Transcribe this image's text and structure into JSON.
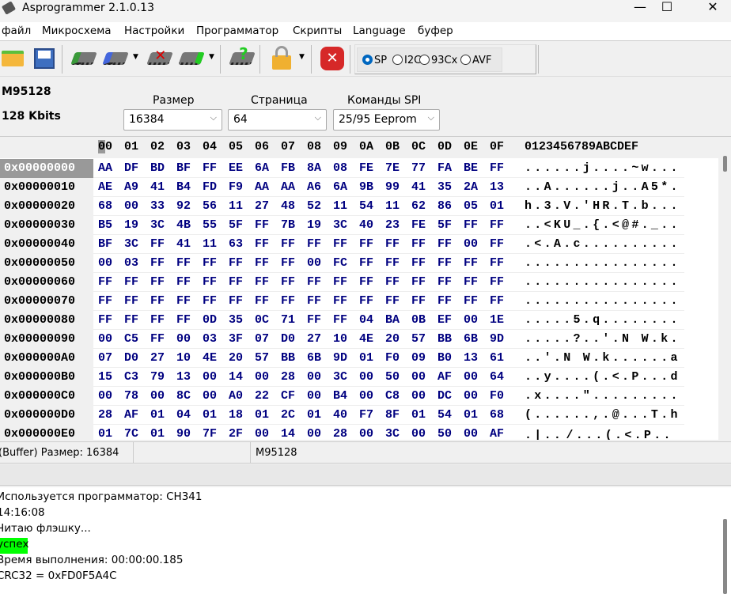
{
  "window": {
    "title": "Asprogrammer 2.1.0.13",
    "minimize": "—",
    "maximize": "☐",
    "close": "✕"
  },
  "menu": [
    "файл",
    "Микросхема",
    "Настройки",
    "Программатор",
    "Скрипты",
    "Language",
    "буфер"
  ],
  "toolbar": {
    "icons": [
      "open-folder-icon",
      "save-icon",
      "read-chip-icon",
      "write-chip-icon",
      "erase-chip-icon",
      "verify-chip-icon",
      "detect-chip-icon",
      "lock-icon",
      "stop-icon"
    ]
  },
  "interfaces": {
    "selected": "SPI",
    "options": [
      "SP",
      "I2C",
      "93Cx",
      "AVF"
    ]
  },
  "chip": {
    "name": "M95128",
    "size_text": "128 Kbits"
  },
  "size": {
    "label": "Размер",
    "value": "16384"
  },
  "page": {
    "label": "Страница",
    "value": "64"
  },
  "spi_commands": {
    "label": "Команды SPI",
    "value": "25/95 Eeprom"
  },
  "hex": {
    "columns": [
      "00",
      "01",
      "02",
      "03",
      "04",
      "05",
      "06",
      "07",
      "08",
      "09",
      "0A",
      "0B",
      "0C",
      "0D",
      "0E",
      "0F"
    ],
    "ascii_header": "0123456789ABCDEF",
    "rows": [
      {
        "addr": "0x00000000",
        "bytes": "AA DF BD BF FF EE 6A FB 8A 08 FE 7E 77 FA BE FF",
        "ascii": "......j....~w..."
      },
      {
        "addr": "0x00000010",
        "bytes": "AE A9 41 B4 FD F9 AA AA A6 6A 9B 99 41 35 2A 13",
        "ascii": "..A......j..A5*."
      },
      {
        "addr": "0x00000020",
        "bytes": "68 00 33 92 56 11 27 48 52 11 54 11 62 86 05 01",
        "ascii": "h.3.V.'HR.T.b..."
      },
      {
        "addr": "0x00000030",
        "bytes": "B5 19 3C 4B 55 5F FF 7B 19 3C 40 23 FE 5F FF FF",
        "ascii": "..<KU_.{.<@#._.."
      },
      {
        "addr": "0x00000040",
        "bytes": "BF 3C FF 41 11 63 FF FF FF FF FF FF FF FF 00 FF",
        "ascii": ".<.A.c.........."
      },
      {
        "addr": "0x00000050",
        "bytes": "00 03 FF FF FF FF FF FF 00 FC FF FF FF FF FF FF",
        "ascii": "................"
      },
      {
        "addr": "0x00000060",
        "bytes": "FF FF FF FF FF FF FF FF FF FF FF FF FF FF FF FF",
        "ascii": "................"
      },
      {
        "addr": "0x00000070",
        "bytes": "FF FF FF FF FF FF FF FF FF FF FF FF FF FF FF FF",
        "ascii": "................"
      },
      {
        "addr": "0x00000080",
        "bytes": "FF FF FF FF 0D 35 0C 71 FF FF 04 BA 0B EF 00 1E",
        "ascii": ".....5.q........"
      },
      {
        "addr": "0x00000090",
        "bytes": "00 C5 FF 00 03 3F 07 D0 27 10 4E 20 57 BB 6B 9D",
        "ascii": ".....?..'.N W.k."
      },
      {
        "addr": "0x000000A0",
        "bytes": "07 D0 27 10 4E 20 57 BB 6B 9D 01 F0 09 B0 13 61",
        "ascii": "..'.N W.k......a"
      },
      {
        "addr": "0x000000B0",
        "bytes": "15 C3 79 13 00 14 00 28 00 3C 00 50 00 AF 00 64",
        "ascii": "..y....(.<.P...d"
      },
      {
        "addr": "0x000000C0",
        "bytes": "00 78 00 8C 00 A0 22 CF 00 B4 00 C8 00 DC 00 F0",
        "ascii": ".x....\"........."
      },
      {
        "addr": "0x000000D0",
        "bytes": "28 AF 01 04 01 18 01 2C 01 40 F7 8F 01 54 01 68",
        "ascii": "(......,.@...T.h"
      },
      {
        "addr": "0x000000E0",
        "bytes": "01 7C 01 90 7F 2F 00 14 00 28 00 3C 00 50 00 AF",
        "ascii": ".|../...(.<.P.."
      }
    ]
  },
  "status": {
    "buffer": "(Buffer) Размер: 16384",
    "chip": "M95128"
  },
  "log": [
    "Используется программатор: CH341",
    "14:16:08",
    "Читаю флэшку...",
    "успех",
    "Время выполнения: 00:00:00.185",
    "CRC32 = 0xFD0F5A4C"
  ],
  "colors": {
    "hex_text": "#000080",
    "success_bg": "#00ff00",
    "selected_radio": "#0067c0"
  }
}
